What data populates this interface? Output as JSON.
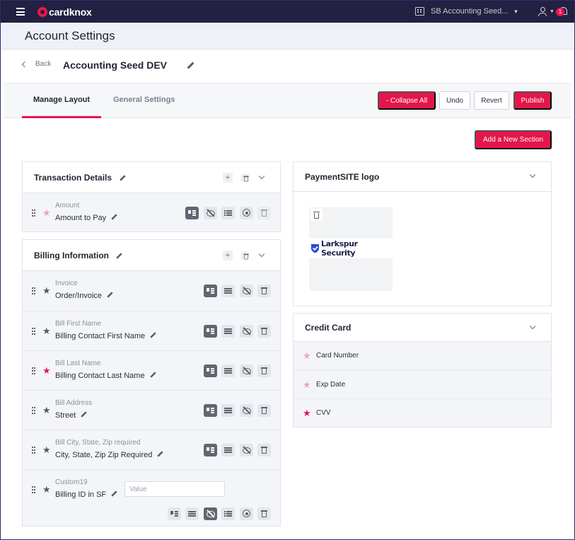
{
  "topbar": {
    "brand": "cardknox",
    "account_switch": "SB Accounting Seed...",
    "notification_count": "1"
  },
  "header": {
    "title": "Account Settings",
    "back_label": "Back",
    "account_name": "Accounting Seed DEV"
  },
  "tabs": {
    "manage_layout": "Manage Layout",
    "general_settings": "General Settings"
  },
  "toolbar": {
    "collapse_all": "- Collapse All",
    "undo": "Undo",
    "revert": "Revert",
    "publish": "Publish",
    "add_section": "Add a New Section"
  },
  "transaction": {
    "title": "Transaction Details",
    "fields": [
      {
        "small": "Amount",
        "main": "Amount to Pay"
      }
    ]
  },
  "billing": {
    "title": "Billing Information",
    "fields": [
      {
        "small": "Invoice",
        "main": "Order/Invoice"
      },
      {
        "small": "Bill First Name",
        "main": "Billing Contact First Name"
      },
      {
        "small": "Bill Last Name",
        "main": "Billing Contact Last Name"
      },
      {
        "small": "Bill Address",
        "main": "Street"
      },
      {
        "small": "Bill City, State, Zip required",
        "main": "City, State, Zip Zip Required"
      },
      {
        "small": "Custom19",
        "main": "Billing ID in SF",
        "value_placeholder": "Value"
      }
    ]
  },
  "logo_panel": {
    "title": "PaymentSITE logo",
    "logo_text": "Larkspur Security"
  },
  "credit_card": {
    "title": "Credit Card",
    "fields": [
      "Card Number",
      "Exp Date",
      "CVV"
    ]
  },
  "colors": {
    "accent": "#e4154a",
    "topbar": "#232041",
    "star_required": "#e4154a",
    "star_optional": "#f2a2b6"
  }
}
